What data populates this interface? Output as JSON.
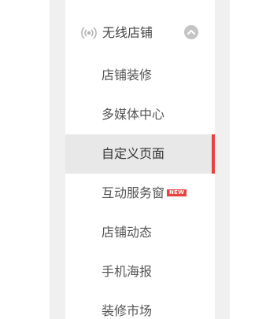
{
  "section": {
    "icon": "wireless-signal-icon",
    "title": "无线店铺",
    "toggle_icon": "chevron-up-circle-icon"
  },
  "menu": {
    "items": [
      {
        "label": "店铺装修"
      },
      {
        "label": "多媒体中心"
      },
      {
        "label": "自定义页面",
        "active": true
      },
      {
        "label": "互动服务窗",
        "badge": "NEW"
      },
      {
        "label": "店铺动态"
      },
      {
        "label": "手机海报"
      },
      {
        "label": "装修市场"
      }
    ]
  },
  "colors": {
    "active_bar": "#e64340",
    "active_bg": "#e8e8e8",
    "badge": "#e8433f",
    "frame": "#f0f0f0"
  }
}
